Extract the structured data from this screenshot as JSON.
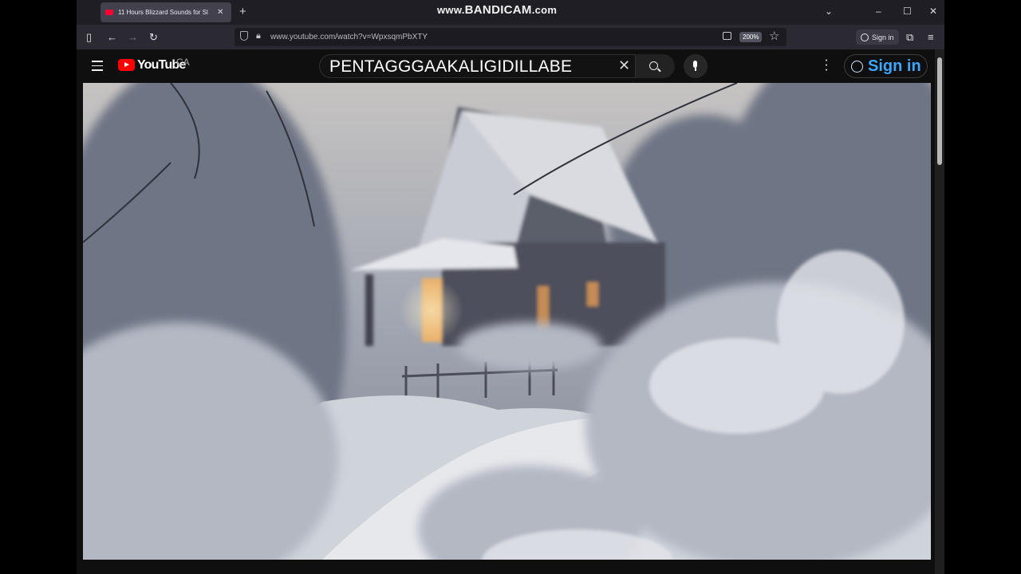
{
  "browser": {
    "tab_title": "11 Hours Blizzard Sounds for Sl",
    "url": "www.youtube.com/watch?v=WpxsqmPbXTY",
    "zoom": "200%",
    "sign_in_label": "Sign in"
  },
  "watermark": {
    "www": "www.",
    "brand": "BANDICAM",
    "tld": ".com"
  },
  "youtube": {
    "logo_text": "YouTube",
    "country_code": "CA",
    "search_query": "PENTAGGGAAKALIGIDILLABE",
    "sign_in_label": "Sign in"
  },
  "icons": [
    "sidebar-icon",
    "back-icon",
    "forward-icon",
    "reload-icon",
    "shield-icon",
    "lock-icon",
    "reader-icon",
    "star-icon",
    "extensions-icon",
    "menu-icon",
    "hamburger-icon",
    "youtube-logo-icon",
    "clear-icon",
    "search-icon",
    "mic-icon",
    "more-icon",
    "account-icon"
  ],
  "colors": {
    "youtube_red": "#ff0000",
    "link_blue": "#3ea6ff",
    "browser_bg": "#2b2a33"
  }
}
